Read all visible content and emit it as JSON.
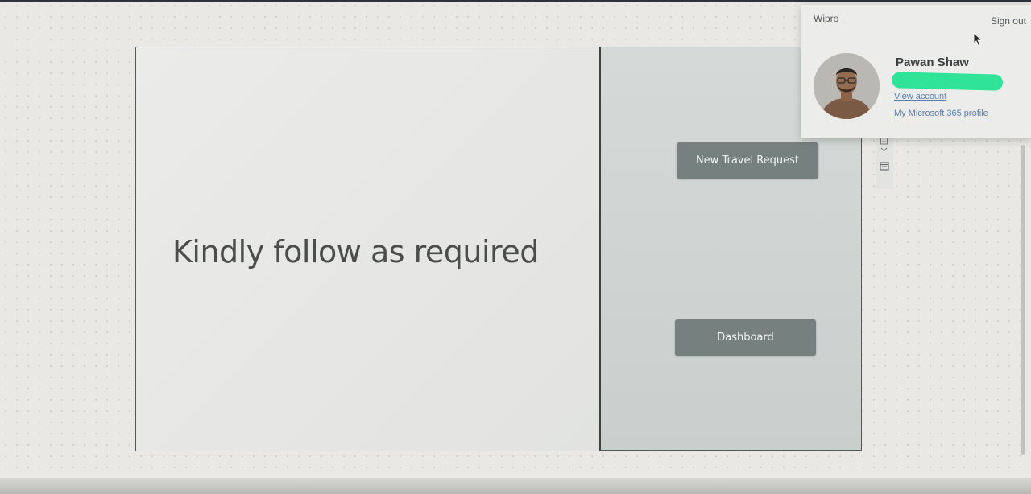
{
  "canvas": {
    "message": "Kindly follow as required",
    "buttons": {
      "new_travel_request": "New Travel Request",
      "dashboard": "Dashboard"
    }
  },
  "side_toolbar": {
    "icons": [
      "page-icon",
      "chevron-down-icon",
      "calendar-icon"
    ]
  },
  "account_popup": {
    "organization": "Wipro",
    "sign_out_label": "Sign out",
    "user_name": "Pawan Shaw",
    "view_account_label": "View account",
    "profile_link_label": "My Microsoft 365 profile",
    "redaction_color": "#2fe398"
  },
  "colors": {
    "button_bg": "#76817f",
    "panel_bg": "#d4dad8",
    "link": "#5b7fb0"
  }
}
